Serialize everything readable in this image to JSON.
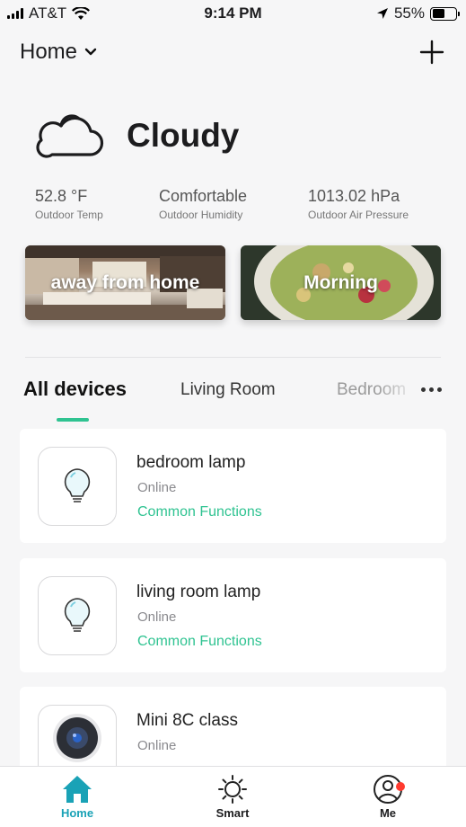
{
  "status_bar": {
    "carrier": "AT&T",
    "time": "9:14 PM",
    "battery": "55%",
    "battery_level": 0.55
  },
  "header": {
    "title": "Home"
  },
  "weather": {
    "condition": "Cloudy",
    "stats": [
      {
        "value": "52.8 °F",
        "label": "Outdoor Temp"
      },
      {
        "value": "Comfortable",
        "label": "Outdoor Humidity"
      },
      {
        "value": "1013.02 hPa",
        "label": "Outdoor Air Pressure"
      }
    ]
  },
  "scenes": [
    {
      "label": "away from home"
    },
    {
      "label": "Morning"
    }
  ],
  "tabs": [
    {
      "label": "All devices"
    },
    {
      "label": "Living Room"
    },
    {
      "label": "Bedroom"
    }
  ],
  "devices": [
    {
      "name": "bedroom lamp",
      "status": "Online",
      "function": "Common Functions",
      "icon": "light-bulb-icon"
    },
    {
      "name": "living room lamp",
      "status": "Online",
      "function": "Common Functions",
      "icon": "light-bulb-icon"
    },
    {
      "name": "Mini 8C class",
      "status": "Online",
      "icon": "camera-icon"
    }
  ],
  "tab_bar": [
    {
      "label": "Home"
    },
    {
      "label": "Smart"
    },
    {
      "label": "Me"
    }
  ],
  "colors": {
    "accent": "#2fc391",
    "home_tab": "#1aa2b6",
    "badge": "#ff3b30"
  }
}
